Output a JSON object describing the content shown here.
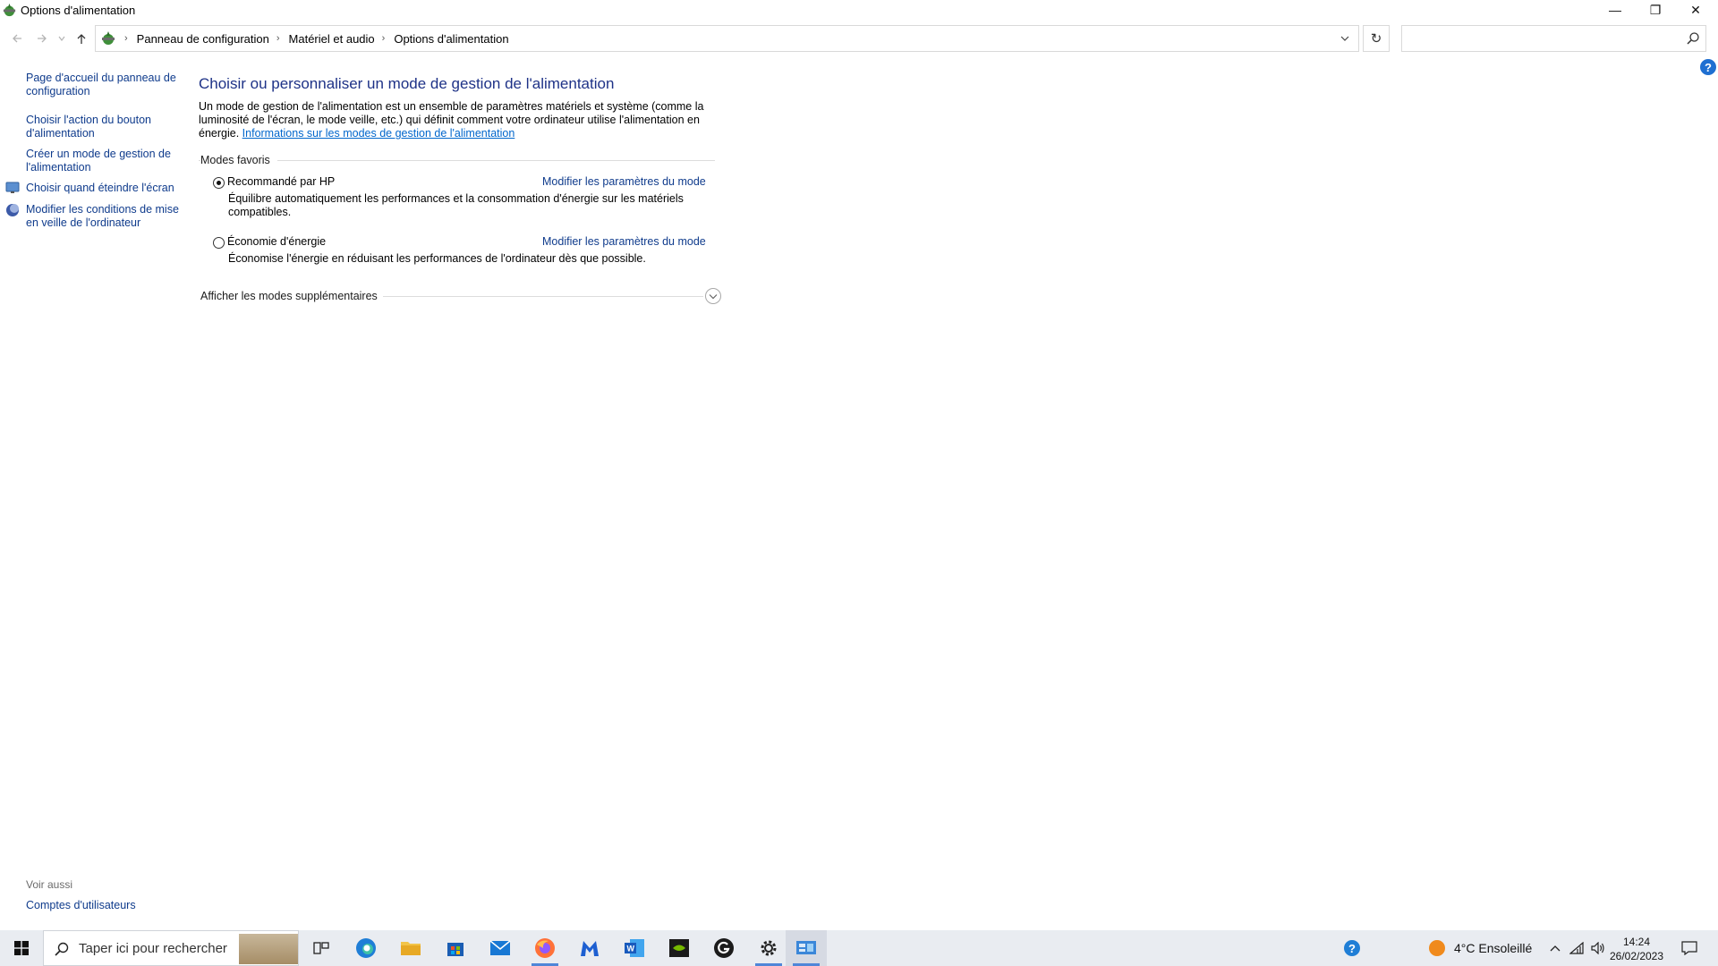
{
  "window": {
    "title": "Options d'alimentation",
    "minimize_glyph": "—",
    "maximize_glyph": "❐",
    "close_glyph": "✕"
  },
  "addressbar": {
    "breadcrumbs": [
      "Panneau de configuration",
      "Matériel et audio",
      "Options d'alimentation"
    ],
    "search_placeholder": ""
  },
  "sidebar": {
    "links": [
      "Page d'accueil du panneau de configuration",
      "Choisir l'action du bouton d'alimentation",
      "Créer un mode de gestion de l'alimentation",
      "Choisir quand éteindre l'écran",
      "Modifier les conditions de mise en veille de l'ordinateur"
    ],
    "see_also_label": "Voir aussi",
    "see_also_links": [
      "Comptes d'utilisateurs"
    ]
  },
  "main": {
    "title": "Choisir ou personnaliser un mode de gestion de l'alimentation",
    "intro_text": "Un mode de gestion de l'alimentation est un ensemble de paramètres matériels et système (comme la luminosité de l'écran, le mode veille, etc.) qui définit comment votre ordinateur utilise l'alimentation en énergie.",
    "intro_link": "Informations sur les modes de gestion de l'alimentation",
    "group_label": "Modes favoris",
    "plans": [
      {
        "name": "Recommandé par HP",
        "selected": true,
        "edit_label": "Modifier les paramètres du mode",
        "description": "Équilibre automatiquement les performances et la consommation d'énergie sur les matériels compatibles."
      },
      {
        "name": "Économie d'énergie",
        "selected": false,
        "edit_label": "Modifier les paramètres du mode",
        "description": "Économise l'énergie en réduisant les performances de l'ordinateur dès que possible."
      }
    ],
    "more_plans_label": "Afficher les modes supplémentaires"
  },
  "taskbar": {
    "search_placeholder": "Taper ici pour rechercher",
    "apps": [
      "task-view",
      "edge",
      "file-explorer",
      "store",
      "mail",
      "firefox",
      "malwarebytes",
      "word",
      "nvidia",
      "g-app",
      "settings",
      "control-panel"
    ],
    "weather": "4°C  Ensoleillé",
    "time": "14:24",
    "date": "26/02/2023"
  },
  "colors": {
    "link": "#0f3b8c",
    "title": "#1e3287",
    "hyperlink": "#0066cc",
    "taskbar": "#e9ecf1"
  }
}
